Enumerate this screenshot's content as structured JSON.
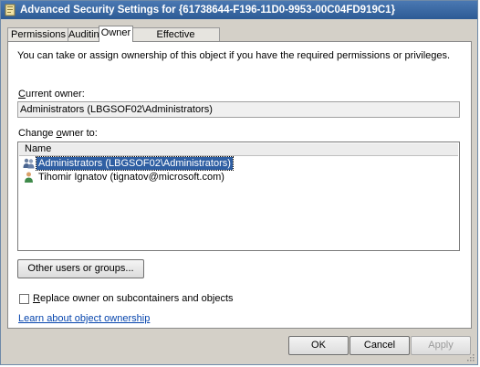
{
  "window": {
    "title": "Advanced Security Settings for {61738644-F196-11D0-9953-00C04FD919C1}",
    "title_icon": "folder-icon"
  },
  "tabs": [
    {
      "label": "Permissions",
      "active": false
    },
    {
      "label": "Auditing",
      "active": false
    },
    {
      "label": "Owner",
      "active": true
    },
    {
      "label": "Effective Permissions",
      "active": false
    }
  ],
  "owner_tab": {
    "intro": "You can take or assign ownership of this object if you have the required permissions or privileges.",
    "current_owner_label_pre": "",
    "current_owner_label_ul": "C",
    "current_owner_label_post": "urrent owner:",
    "current_owner_value": "Administrators (LBGSOF02\\Administrators)",
    "change_owner_label_pre": "Change ",
    "change_owner_label_ul": "o",
    "change_owner_label_post": "wner to:",
    "list_header": "Name",
    "owners": [
      {
        "name": "Administrators (LBGSOF02\\Administrators)",
        "icon": "group-icon",
        "selected": true
      },
      {
        "name": "Tihomir Ignatov (tignatov@microsoft.com)",
        "icon": "user-icon",
        "selected": false
      }
    ],
    "other_users_button": "Other users or groups...",
    "replace_checkbox_label_pre": "",
    "replace_checkbox_label_ul": "R",
    "replace_checkbox_label_post": "eplace owner on subcontainers and objects",
    "replace_checked": false,
    "learn_link": "Learn about object ownership"
  },
  "footer": {
    "ok": "OK",
    "cancel": "Cancel",
    "apply": "Apply",
    "apply_enabled": false
  }
}
